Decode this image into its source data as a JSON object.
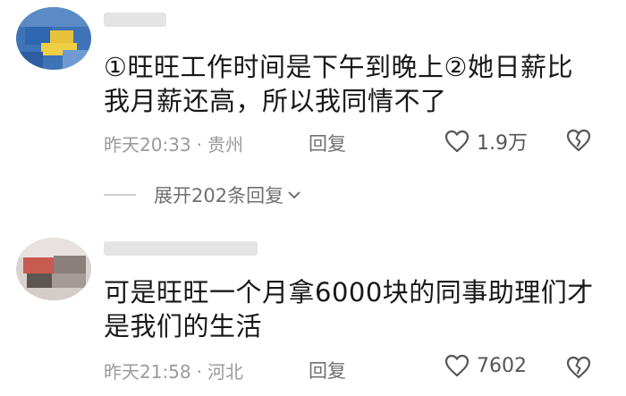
{
  "comments": [
    {
      "text_lines": [
        "①旺旺工作时间是下午到晚上②她日薪比",
        "我月薪还高，所以我同情不了"
      ],
      "time": "昨天20:33",
      "location": "贵州",
      "reply_label": "回复",
      "likes": "1.9万"
    },
    {
      "text_lines": [
        "可是旺旺一个月拿6000块的同事助理们才",
        "是我们的生活"
      ],
      "time": "昨天21:58",
      "location": "河北",
      "reply_label": "回复",
      "likes": "7602"
    }
  ],
  "expand_replies": "展开202条回复",
  "meta_separator": "·",
  "icons": {
    "like": "heart-outline-icon",
    "dislike": "broken-heart-icon",
    "expand": "chevron-down-icon"
  },
  "colors": {
    "text": "#181818",
    "meta": "#9a9a9a",
    "action": "#707070"
  }
}
